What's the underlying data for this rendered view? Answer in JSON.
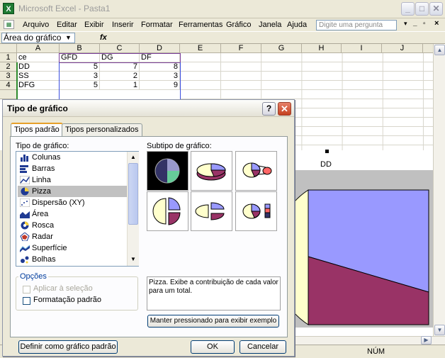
{
  "window": {
    "title": "Microsoft Excel - Pasta1",
    "app_icon": "X"
  },
  "menu": {
    "items": [
      "Arquivo",
      "Editar",
      "Exibir",
      "Inserir",
      "Formatar",
      "Ferramentas",
      "Gráfico",
      "Janela",
      "Ajuda"
    ],
    "ask_placeholder": "Digite uma pergunta"
  },
  "formula_bar": {
    "name_box": "Área do gráfico",
    "fx": "fx"
  },
  "sheet": {
    "columns": [
      "A",
      "B",
      "C",
      "D",
      "E",
      "F",
      "G",
      "H",
      "I",
      "J"
    ],
    "rows": [
      {
        "n": "1",
        "cells": [
          "ce",
          "GFD",
          "DG",
          "DF"
        ]
      },
      {
        "n": "2",
        "cells": [
          "DD",
          "5",
          "7",
          "8"
        ]
      },
      {
        "n": "3",
        "cells": [
          "SS",
          "3",
          "2",
          "3"
        ]
      },
      {
        "n": "4",
        "cells": [
          "DFG",
          "5",
          "1",
          "9"
        ]
      }
    ]
  },
  "chart": {
    "title": "DD",
    "slice_colors": [
      "#9999ff",
      "#993366",
      "#ffffcc"
    ]
  },
  "status": {
    "num": "NÚM"
  },
  "dialog": {
    "title": "Tipo de gráfico",
    "tabs": [
      "Tipos padrão",
      "Tipos personalizados"
    ],
    "type_label": "Tipo de gráfico:",
    "subtype_label": "Subtipo de gráfico:",
    "types": [
      "Colunas",
      "Barras",
      "Linha",
      "Pizza",
      "Dispersão (XY)",
      "Área",
      "Rosca",
      "Radar",
      "Superfície",
      "Bolhas"
    ],
    "selected_type": "Pizza",
    "options_legend": "Opções",
    "option_apply": "Aplicar à seleção",
    "option_default_format": "Formatação padrão",
    "description": "Pizza. Exibe a contribuição de cada valor para um total.",
    "hold_button": "Manter pressionado para exibir exemplo",
    "set_default_button": "Definir como gráfico padrão",
    "ok_button": "OK",
    "cancel_button": "Cancelar"
  }
}
